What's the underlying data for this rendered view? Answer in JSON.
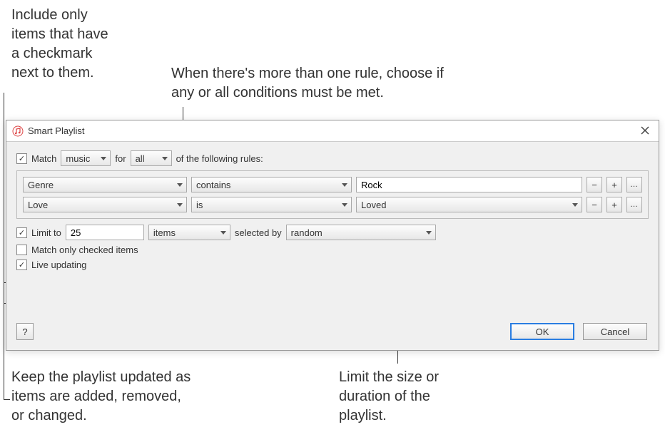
{
  "annotations": {
    "checkmark": "Include only\nitems that have\na checkmark\nnext to them.",
    "conditions": "When there's more than one rule, choose if\nany or all conditions must be met.",
    "live_updating": "Keep the playlist updated as\nitems are added, removed,\nor changed.",
    "limit": "Limit the size or\nduration of the\nplaylist."
  },
  "dialog": {
    "title": "Smart Playlist",
    "match_row": {
      "match_label": "Match",
      "type_value": "music",
      "for_label": "for",
      "conditions_value": "all",
      "suffix_label": "of the following rules:"
    },
    "rules": [
      {
        "field": "Genre",
        "operator": "contains",
        "value": "Rock",
        "value_type": "text"
      },
      {
        "field": "Love",
        "operator": "is",
        "value": "Loved",
        "value_type": "select"
      }
    ],
    "limit_row": {
      "label": "Limit to",
      "count": "25",
      "unit": "items",
      "selected_by_label": "selected by",
      "selected_by_value": "random"
    },
    "match_checked_label": "Match only checked items",
    "live_updating_label": "Live updating",
    "help_label": "?",
    "ok_label": "OK",
    "cancel_label": "Cancel"
  }
}
